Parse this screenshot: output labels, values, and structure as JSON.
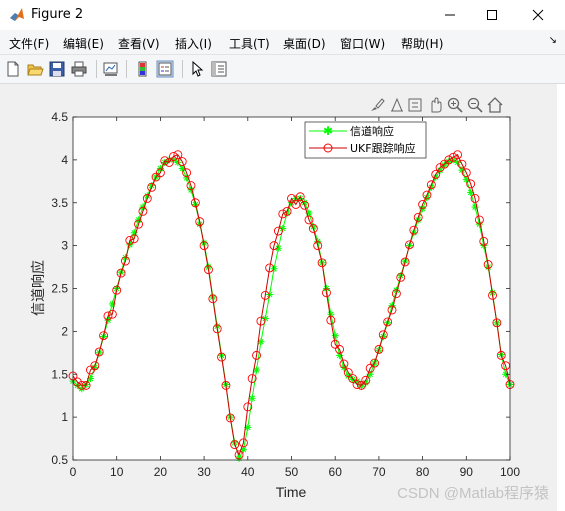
{
  "window": {
    "title": "Figure 2",
    "minimize_icon": "minimize-icon",
    "maximize_icon": "maximize-icon",
    "close_icon": "close-icon"
  },
  "menu": {
    "items": [
      "文件(F)",
      "编辑(E)",
      "查看(V)",
      "插入(I)",
      "工具(T)",
      "桌面(D)",
      "窗口(W)",
      "帮助(H)"
    ]
  },
  "toolbar": {
    "icons": [
      "new-figure-icon",
      "open-file-icon",
      "save-icon",
      "print-icon",
      "link-plot-icon",
      "insert-colorbar-icon",
      "insert-legend-icon",
      "select-pointer-icon",
      "property-inspector-icon"
    ]
  },
  "axes_toolbar": {
    "icons": [
      "brush-icon",
      "data-tips-icon",
      "save-axes-icon",
      "pan-icon",
      "zoom-in-icon",
      "zoom-out-icon",
      "home-restore-icon"
    ]
  },
  "watermark": "CSDN @Matlab程序猿",
  "colors": {
    "channel": "#00ff00",
    "ukf": "#ff0000",
    "ukf_line": "#cc0000"
  },
  "chart_data": {
    "type": "line",
    "title": "",
    "xlabel": "Time",
    "ylabel": "信道响应",
    "xlim": [
      0,
      100
    ],
    "ylim": [
      0.5,
      4.5
    ],
    "xticks": [
      0,
      10,
      20,
      30,
      40,
      50,
      60,
      70,
      80,
      90,
      100
    ],
    "yticks": [
      0.5,
      1,
      1.5,
      2,
      2.5,
      3,
      3.5,
      4,
      4.5
    ],
    "grid": false,
    "legend_position": "top-right",
    "series": [
      {
        "name": "信道响应",
        "marker": "*",
        "x": [
          0,
          1,
          2,
          3,
          4,
          5,
          6,
          7,
          8,
          9,
          10,
          11,
          12,
          13,
          14,
          15,
          16,
          17,
          18,
          19,
          20,
          21,
          22,
          23,
          24,
          25,
          26,
          27,
          28,
          29,
          30,
          31,
          32,
          33,
          34,
          35,
          36,
          37,
          38,
          39,
          40,
          41,
          42,
          43,
          44,
          45,
          46,
          47,
          48,
          49,
          50,
          51,
          52,
          53,
          54,
          55,
          56,
          57,
          58,
          59,
          60,
          61,
          62,
          63,
          64,
          65,
          66,
          67,
          68,
          69,
          70,
          71,
          72,
          73,
          74,
          75,
          76,
          77,
          78,
          79,
          80,
          81,
          82,
          83,
          84,
          85,
          86,
          87,
          88,
          89,
          90,
          91,
          92,
          93,
          94,
          95,
          96,
          97,
          98,
          99,
          100
        ],
        "values": [
          1.42,
          1.37,
          1.33,
          1.38,
          1.45,
          1.58,
          1.75,
          1.94,
          2.13,
          2.32,
          2.5,
          2.69,
          2.86,
          3.01,
          3.15,
          3.3,
          3.45,
          3.58,
          3.7,
          3.8,
          3.9,
          3.97,
          4.0,
          4.0,
          3.97,
          3.9,
          3.79,
          3.65,
          3.48,
          3.25,
          3.03,
          2.75,
          2.4,
          2.06,
          1.72,
          1.38,
          1.0,
          0.7,
          0.52,
          0.62,
          0.88,
          1.22,
          1.55,
          1.88,
          2.15,
          2.43,
          2.73,
          2.97,
          3.2,
          3.38,
          3.5,
          3.55,
          3.55,
          3.5,
          3.38,
          3.22,
          3.05,
          2.8,
          2.5,
          2.2,
          1.95,
          1.72,
          1.58,
          1.48,
          1.44,
          1.42,
          1.36,
          1.4,
          1.5,
          1.63,
          1.78,
          1.94,
          2.1,
          2.3,
          2.48,
          2.65,
          2.82,
          3.0,
          3.15,
          3.3,
          3.43,
          3.56,
          3.68,
          3.8,
          3.88,
          3.94,
          3.98,
          4.0,
          3.97,
          3.88,
          3.77,
          3.62,
          3.45,
          3.25,
          3.0,
          2.75,
          2.45,
          2.1,
          1.73,
          1.5,
          1.38
        ]
      },
      {
        "name": "UKF跟踪响应",
        "marker": "o",
        "x": [
          0,
          1,
          2,
          3,
          4,
          5,
          6,
          7,
          8,
          9,
          10,
          11,
          12,
          13,
          14,
          15,
          16,
          17,
          18,
          19,
          20,
          21,
          22,
          23,
          24,
          25,
          26,
          27,
          28,
          29,
          30,
          31,
          32,
          33,
          34,
          35,
          36,
          37,
          38,
          39,
          40,
          41,
          42,
          43,
          44,
          45,
          46,
          47,
          48,
          49,
          50,
          51,
          52,
          53,
          54,
          55,
          56,
          57,
          58,
          59,
          60,
          61,
          62,
          63,
          64,
          65,
          66,
          67,
          68,
          69,
          70,
          71,
          72,
          73,
          74,
          75,
          76,
          77,
          78,
          79,
          80,
          81,
          82,
          83,
          84,
          85,
          86,
          87,
          88,
          89,
          90,
          91,
          92,
          93,
          94,
          95,
          96,
          97,
          98,
          99,
          100
        ],
        "values": [
          1.48,
          1.41,
          1.37,
          1.37,
          1.55,
          1.6,
          1.76,
          1.95,
          2.18,
          2.2,
          2.48,
          2.68,
          2.82,
          3.06,
          3.08,
          3.25,
          3.4,
          3.55,
          3.68,
          3.8,
          3.85,
          3.99,
          3.97,
          4.04,
          4.06,
          3.98,
          3.85,
          3.7,
          3.5,
          3.28,
          3.0,
          2.72,
          2.38,
          2.03,
          1.7,
          1.37,
          0.99,
          0.68,
          0.56,
          0.7,
          1.12,
          1.45,
          1.72,
          2.12,
          2.42,
          2.74,
          3.0,
          3.17,
          3.37,
          3.4,
          3.55,
          3.48,
          3.57,
          3.47,
          3.3,
          3.2,
          3.0,
          2.8,
          2.45,
          2.13,
          1.85,
          1.79,
          1.62,
          1.52,
          1.45,
          1.38,
          1.37,
          1.43,
          1.57,
          1.63,
          1.79,
          1.96,
          2.11,
          2.25,
          2.44,
          2.63,
          2.81,
          3.01,
          3.18,
          3.33,
          3.48,
          3.59,
          3.71,
          3.83,
          3.91,
          3.95,
          4.0,
          4.03,
          4.06,
          3.95,
          3.85,
          3.72,
          3.55,
          3.3,
          3.05,
          2.78,
          2.42,
          2.1,
          1.72,
          1.6,
          1.38
        ]
      }
    ]
  }
}
